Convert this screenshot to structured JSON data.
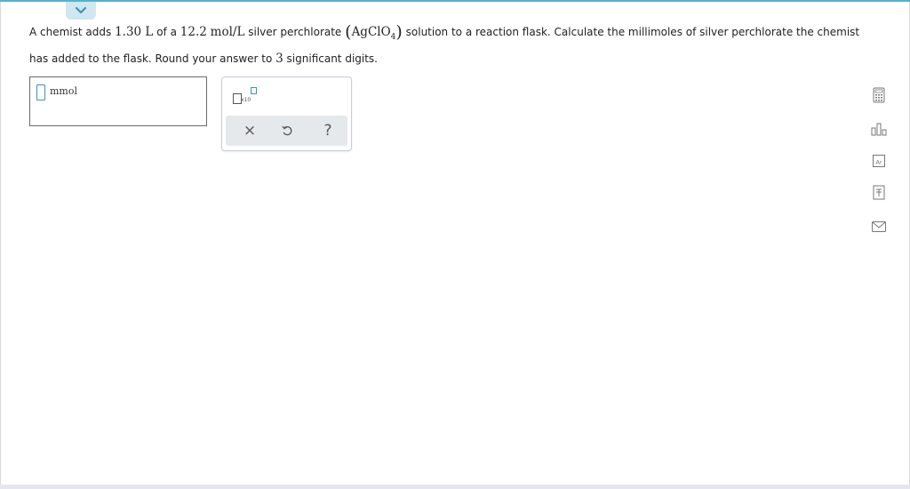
{
  "question": {
    "part1": "A chemist adds ",
    "volume": "1.30 L",
    "part2": " of a ",
    "conc_value": "12.2",
    "conc_unit": "mol/L",
    "part3": " silver perchlorate ",
    "formula_main": "AgClO",
    "formula_sub": "4",
    "part4": " solution to a reaction flask. Calculate the millimoles of silver perchlorate the chemist has added to the flask. Round your answer to ",
    "sig_digits": "3",
    "part5": " significant digits."
  },
  "answer": {
    "value": "",
    "unit": "mmol"
  },
  "tools": {
    "sci_notation_label": "x10",
    "clear_symbol": "×",
    "help_symbol": "?"
  },
  "colors": {
    "accent": "#3d93bd",
    "top_line": "#4fb3cf",
    "tab_bg": "#cfe7f1",
    "action_row_bg": "#e6e9ec"
  },
  "icons": {
    "collapse": "chevron-down-icon",
    "clear": "close-icon",
    "undo": "undo-icon",
    "help": "question-icon",
    "calculator": "calculator-icon",
    "chart": "bar-chart-icon",
    "periodic_table": "periodic-table-icon",
    "reference": "reference-book-icon",
    "email": "mail-icon"
  }
}
